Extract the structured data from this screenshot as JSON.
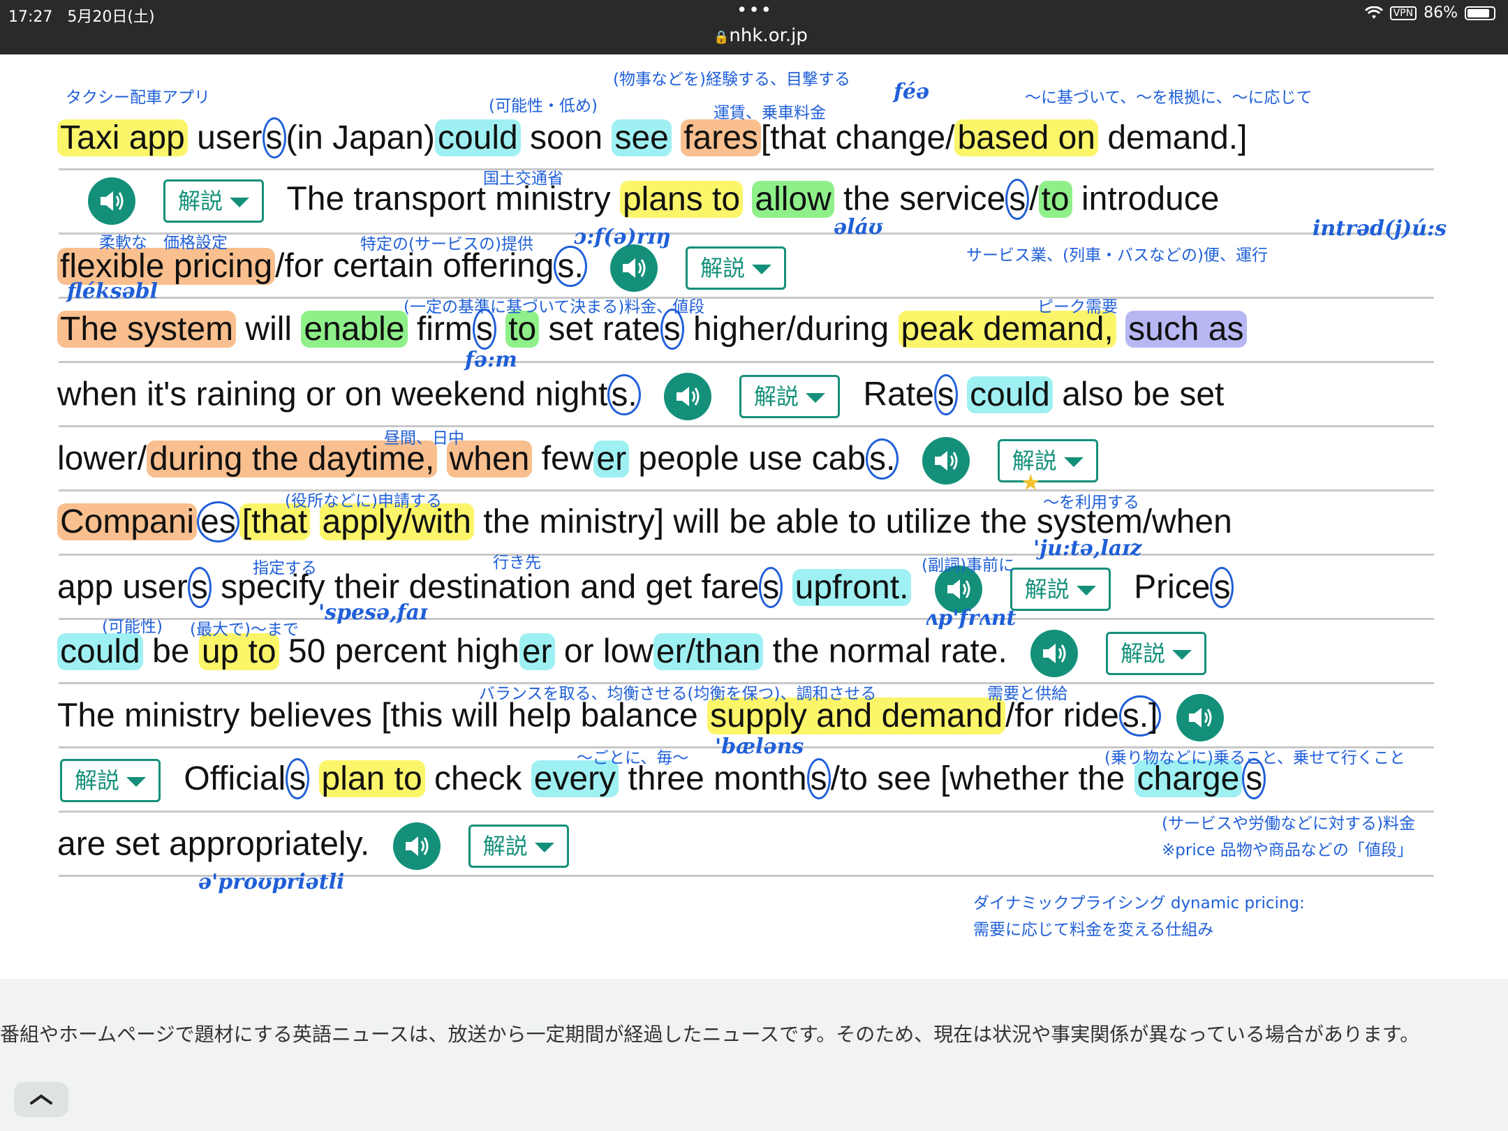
{
  "status_bar": {
    "time": "17:27",
    "date": "5月20日(土)",
    "dots": "•••",
    "url": "nhk.or.jp",
    "vpn": "VPN",
    "battery": "86%",
    "battery_level": 0.86
  },
  "ui": {
    "kaisetsu_label": "解説"
  },
  "sentences": {
    "l1": [
      "Taxi app",
      " user",
      "s",
      "(in Japan)",
      "could",
      " soon ",
      "see",
      " ",
      "fares",
      "[that",
      " change/",
      "based on",
      " demand.]"
    ],
    "l2": [
      "The transport ministry ",
      "plans to",
      " ",
      "allow",
      " the service",
      "s",
      "/",
      "to",
      " introduce"
    ],
    "l3": [
      "flexible pricing",
      "/for certain offering",
      "s."
    ],
    "l4": [
      "The system",
      " will ",
      "enable",
      " firm",
      "s",
      " ",
      "to",
      " set rate",
      "s",
      " higher/during ",
      "peak demand,",
      " ",
      "such as"
    ],
    "l5": [
      "when it's raining or on weekend night",
      "s.",
      "Rate",
      "s",
      " ",
      "could",
      " also be set"
    ],
    "l6": [
      "lower/",
      "during the daytime,",
      " ",
      "when",
      " few",
      "er",
      " people use cab",
      "s."
    ],
    "l7": [
      "Compani",
      "es",
      "[that",
      " ",
      "apply/with",
      " the ministry]",
      " will be able to utilize the system/when"
    ],
    "l8": [
      "app user",
      "s",
      " specify their destination and get fare",
      "s",
      " ",
      "upfront.",
      "Price",
      "s"
    ],
    "l9": [
      "could",
      " be ",
      "up to",
      " 50 percent high",
      "er",
      " or low",
      "er/than",
      " the normal rate."
    ],
    "l10": [
      "The ministry believes ",
      "[this will help balance ",
      "supply and demand",
      "/for ride",
      "s.]"
    ],
    "l11": [
      "Official",
      "s",
      " ",
      "plan to",
      " check ",
      "every",
      " three month",
      "s",
      "/to see [whether the ",
      "charge",
      "s"
    ],
    "l12": [
      "are set appropriately."
    ]
  },
  "notes": {
    "n1": "タクシー配車アプリ",
    "n2": "(可能性・低め)",
    "n3": "(物事などを)経験する、目撃する",
    "n4": "運賃、乗車料金",
    "n5": "〜に基づいて、〜を根拠に、〜に応じて",
    "n6": "国土交通省",
    "n7": "柔軟な　価格設定",
    "n8": "特定の(サービスの)提供",
    "n9": "サービス業、(列車・バスなどの)便、運行",
    "n10": "(一定の基準に基づいて決まる)料金、値段",
    "n11": "ピーク需要",
    "n12": "昼間、日中",
    "n13": "(役所などに)申請する",
    "n14": "〜を利用する",
    "n15": "指定する",
    "n16": "行き先",
    "n17": "(副詞)事前に",
    "n18": "(可能性)",
    "n19": "(最大で)〜まで",
    "n20": "バランスを取る、均衡させる(均衡を保つ)、調和させる",
    "n21": "需要と供給",
    "n22": "〜ごとに、毎〜",
    "n23": "(乗り物などに)乗ること、乗せて行くこと",
    "n24": "(サービスや労働などに対する)料金",
    "n25": "※price 品物や商品などの「値段」",
    "n26": "ダイナミックプライシング dynamic pricing:",
    "n27": "需要に応じて料金を変える仕組み"
  },
  "ipa": {
    "p1": "féə",
    "p2": "ɔ:f(ə)rɪŋ",
    "p3": "əláʊ",
    "p4": "intrəd(j)ú:s",
    "p5": "fléksəbl",
    "p6": "fə:m",
    "p7": "'ju:tə,laɪz",
    "p8": "'spesə,faɪ",
    "p9": "ʌp'frʌnt",
    "p10": "'bæləns",
    "p11": "ə'proʊpriətli"
  },
  "footer": {
    "disclaimer": "番組やホームページで題材にする英語ニュースは、放送から一定期間が経過したニュースです。そのため、現在は状況や事実関係が異なっている場合があります。"
  }
}
